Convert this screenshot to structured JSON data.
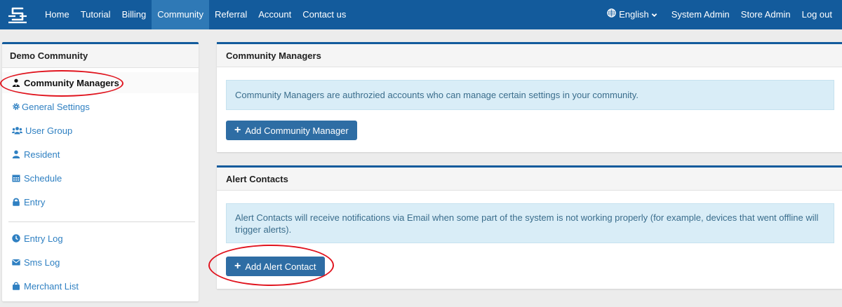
{
  "navbar": {
    "left_items": [
      {
        "label": "Home",
        "active": false
      },
      {
        "label": "Tutorial",
        "active": false
      },
      {
        "label": "Billing",
        "active": false
      },
      {
        "label": "Community",
        "active": true
      },
      {
        "label": "Referral",
        "active": false
      },
      {
        "label": "Account",
        "active": false
      },
      {
        "label": "Contact us",
        "active": false
      }
    ],
    "language": "English",
    "right_items": [
      "System Admin",
      "Store Admin",
      "Log out"
    ]
  },
  "sidebar": {
    "title": "Demo Community",
    "items": [
      {
        "label": "Community Managers",
        "icon": "user-tie-icon",
        "active": true
      },
      {
        "label": "General Settings",
        "icon": "gear-icon",
        "active": false
      },
      {
        "label": "User Group",
        "icon": "users-icon",
        "active": false
      },
      {
        "label": "Resident",
        "icon": "user-icon",
        "active": false
      },
      {
        "label": "Schedule",
        "icon": "calendar-icon",
        "active": false
      },
      {
        "label": "Entry",
        "icon": "lock-icon",
        "active": false
      },
      {
        "label": "Entry Log",
        "icon": "clock-icon",
        "active": false
      },
      {
        "label": "Sms Log",
        "icon": "envelope-icon",
        "active": false
      },
      {
        "label": "Merchant List",
        "icon": "shopping-bag-icon",
        "active": false
      }
    ]
  },
  "managers_panel": {
    "title": "Community Managers",
    "info": "Community Managers are authrozied accounts who can manage certain settings in your community.",
    "button": "Add Community Manager"
  },
  "alerts_panel": {
    "title": "Alert Contacts",
    "info": "Alert Contacts will receive notifications via Email when some part of the system is not working properly (for example, devices that went offline will trigger alerts).",
    "button": "Add Alert Contact"
  },
  "colors": {
    "navbar": "#135b9c",
    "nav_active": "#2f79b6",
    "link": "#2f80c2",
    "button": "#2e6da4",
    "alert_bg": "#d9edf7",
    "annotation": "#e0141e"
  }
}
